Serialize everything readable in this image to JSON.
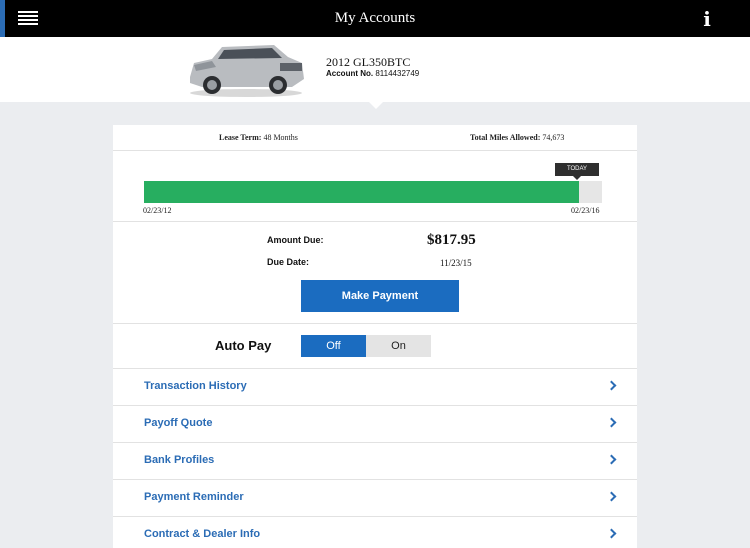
{
  "header": {
    "title": "My Accounts",
    "menu_icon": "hamburger-menu-icon",
    "info_icon": "info-icon"
  },
  "vehicle": {
    "name": "2012 GL350BTC",
    "account_label": "Account No.",
    "account_number": "8114432749"
  },
  "lease": {
    "term_label": "Lease Term:",
    "term_value": "48 Months",
    "miles_label": "Total Miles Allowed:",
    "miles_value": "74,673"
  },
  "progress": {
    "start_date": "02/23/12",
    "end_date": "02/23/16",
    "today_label": "TODAY",
    "fraction": 0.95
  },
  "payment": {
    "amount_label": "Amount Due:",
    "amount_value": "$817.95",
    "date_label": "Due Date:",
    "date_value": "11/23/15",
    "button_label": "Make Payment"
  },
  "autopay": {
    "label": "Auto Pay",
    "off_label": "Off",
    "on_label": "On",
    "selected": "Off"
  },
  "menu_items": [
    {
      "label": "Transaction History"
    },
    {
      "label": "Payoff Quote"
    },
    {
      "label": "Bank Profiles"
    },
    {
      "label": "Payment Reminder"
    },
    {
      "label": "Contract & Dealer Info"
    }
  ],
  "colors": {
    "accent": "#1b6cc0",
    "progress": "#27ae60",
    "link": "#2b6cb5"
  }
}
